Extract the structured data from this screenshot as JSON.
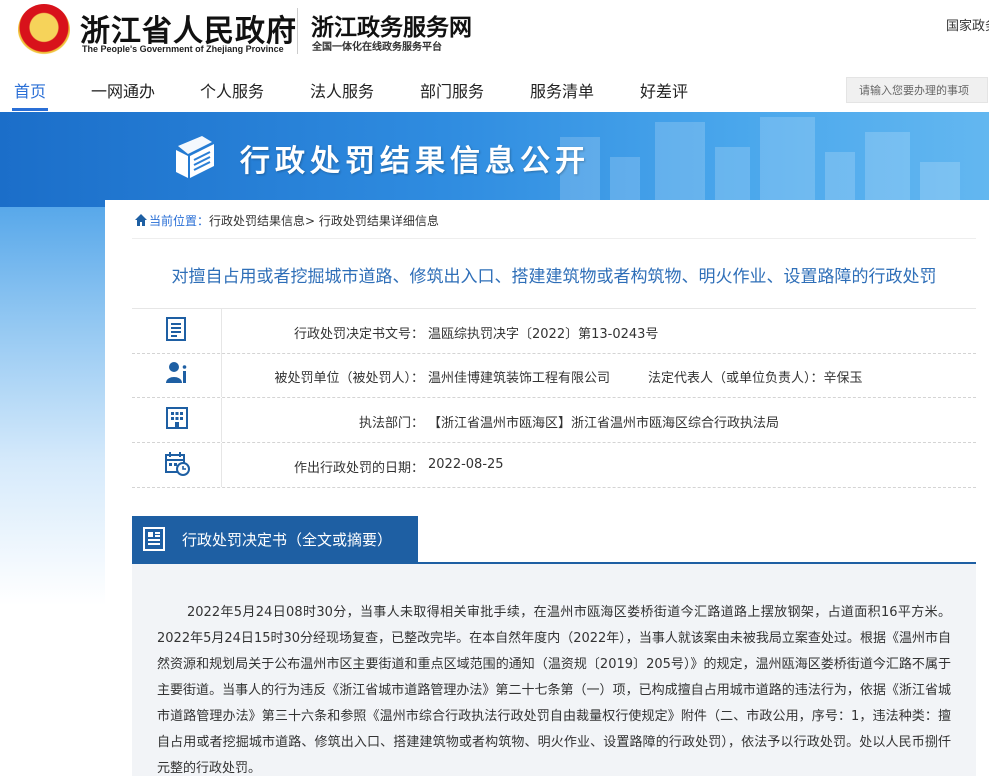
{
  "header": {
    "gov_name": "浙江省人民政府",
    "gov_name_en": "The People's Government of Zhejiang Province",
    "service_name": "浙江政务服务网",
    "service_slogan": "全国一体化在线政务服务平台",
    "top_right_link": "国家政务"
  },
  "nav": {
    "items": [
      "首页",
      "一网通办",
      "个人服务",
      "法人服务",
      "部门服务",
      "服务清单",
      "好差评"
    ],
    "active_index": 0,
    "search_placeholder": "请输入您要办理的事项"
  },
  "banner": {
    "title": "行政处罚结果信息公开"
  },
  "breadcrumb": {
    "home": "当前位置：",
    "path": "行政处罚结果信息> 行政处罚结果详细信息"
  },
  "page_title": "对擅自占用或者挖掘城市道路、修筑出入口、搭建建筑物或者构筑物、明火作业、设置路障的行政处罚",
  "info": {
    "decision_no_label": "行政处罚决定书文号：",
    "decision_no": "温瓯综执罚决字〔2022〕第13-0243号",
    "party_label": "被处罚单位（被处罚人）：",
    "party": "温州佳博建筑装饰工程有限公司",
    "legal_rep_label": "法定代表人（或单位负责人）：",
    "legal_rep": "辛保玉",
    "dept_label": "执法部门：",
    "dept": "【浙江省温州市瓯海区】浙江省温州市瓯海区综合行政执法局",
    "date_label": "作出行政处罚的日期：",
    "date": "2022-08-25"
  },
  "section": {
    "title": "行政处罚决定书（全文或摘要）",
    "body": "2022年5月24日08时30分，当事人未取得相关审批手续，在温州市瓯海区娄桥街道今汇路道路上摆放钢架，占道面积16平方米。2022年5月24日15时30分经现场复查，已整改完毕。在本自然年度内（2022年），当事人就该案由未被我局立案查处过。根据《温州市自然资源和规划局关于公布温州市区主要街道和重点区域范围的通知（温资规〔2019〕205号）》的规定，温州瓯海区娄桥街道今汇路不属于主要街道。当事人的行为违反《浙江省城市道路管理办法》第二十七条第（一）项，已构成擅自占用城市道路的违法行为，依据《浙江省城市道路管理办法》第三十六条和参照《温州市综合行政执法行政处罚自由裁量权行使规定》附件（二、市政公用，序号：1，违法种类：擅自占用或者挖掘城市道路、修筑出入口、搭建建筑物或者构筑物、明火作业、设置路障的行政处罚），依法予以行政处罚。处以人民币捌仟元整的行政处罚。"
  },
  "colors": {
    "accent": "#2a6fd6",
    "section_blue": "#1e5fa3",
    "title_blue": "#2f6fb8"
  }
}
